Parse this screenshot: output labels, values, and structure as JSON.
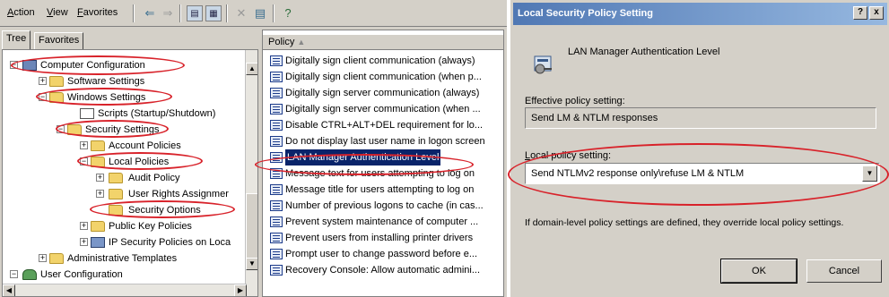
{
  "menubar": {
    "items": [
      {
        "mnemonic": "A",
        "rest": "ction"
      },
      {
        "mnemonic": "V",
        "rest": "iew"
      },
      {
        "mnemonic": "F",
        "rest": "avorites"
      }
    ],
    "toolbar_icons": [
      "back-arrow-icon",
      "forward-arrow-icon",
      "up-folder-icon",
      "show-tree-icon",
      "delete-icon",
      "export-list-icon",
      "help-icon"
    ]
  },
  "tree_pane": {
    "tabs": [
      "Tree",
      "Favorites"
    ],
    "nodes": [
      {
        "label": "Computer Configuration",
        "expander": "−",
        "icon": "computer-icon"
      },
      {
        "label": "Software Settings",
        "expander": "+",
        "icon": "folder-icon"
      },
      {
        "label": "Windows Settings",
        "expander": "−",
        "icon": "folder-icon"
      },
      {
        "label": "Scripts (Startup/Shutdown)",
        "expander": "",
        "icon": "script-icon"
      },
      {
        "label": "Security Settings",
        "expander": "−",
        "icon": "security-folder-icon"
      },
      {
        "label": "Account Policies",
        "expander": "+",
        "icon": "security-folder-icon"
      },
      {
        "label": "Local Policies",
        "expander": "−",
        "icon": "security-folder-icon"
      },
      {
        "label": "Audit Policy",
        "expander": "+",
        "icon": "security-folder-icon"
      },
      {
        "label": "User Rights Assignmer",
        "expander": "+",
        "icon": "security-folder-icon"
      },
      {
        "label": "Security Options",
        "expander": "",
        "icon": "security-folder-icon"
      },
      {
        "label": "Public Key Policies",
        "expander": "+",
        "icon": "folder-icon"
      },
      {
        "label": "IP Security Policies on Loca",
        "expander": "+",
        "icon": "ip-security-icon"
      },
      {
        "label": "Administrative Templates",
        "expander": "+",
        "icon": "folder-icon"
      },
      {
        "label": "User Configuration",
        "expander": "−",
        "icon": "user-icon"
      }
    ]
  },
  "policy_pane": {
    "column_header": "Policy",
    "rows": [
      "Digitally sign client communication (always)",
      "Digitally sign client communication (when p...",
      "Digitally sign server communication (always)",
      "Digitally sign server communication (when ...",
      "Disable CTRL+ALT+DEL requirement for lo...",
      "Do not display last user name in logon screen",
      "LAN Manager Authentication Level",
      "Message text for users attempting to log on",
      "Message title for users attempting to log on",
      "Number of previous logons to cache (in cas...",
      "Prevent system maintenance of computer ...",
      "Prevent users from installing printer drivers",
      "Prompt user to change password before e...",
      "Recovery Console: Allow automatic admini..."
    ],
    "selected_index": 6
  },
  "dialog": {
    "title": "Local Security Policy Setting",
    "help_btn": "?",
    "close_btn": "x",
    "policy_name": "LAN Manager Authentication Level",
    "effective_label": "Effective policy setting:",
    "effective_value": "Send LM & NTLM responses",
    "local_label_mnemonic": "L",
    "local_label_rest": "ocal policy setting:",
    "local_value": "Send NTLMv2 response only\\refuse LM & NTLM",
    "note": "If domain-level policy settings are defined, they override local policy settings.",
    "ok_label": "OK",
    "cancel_label": "Cancel"
  },
  "colors": {
    "annotation": "#d8222a",
    "selection": "#0a246a",
    "window_face": "#d4d0c8"
  }
}
